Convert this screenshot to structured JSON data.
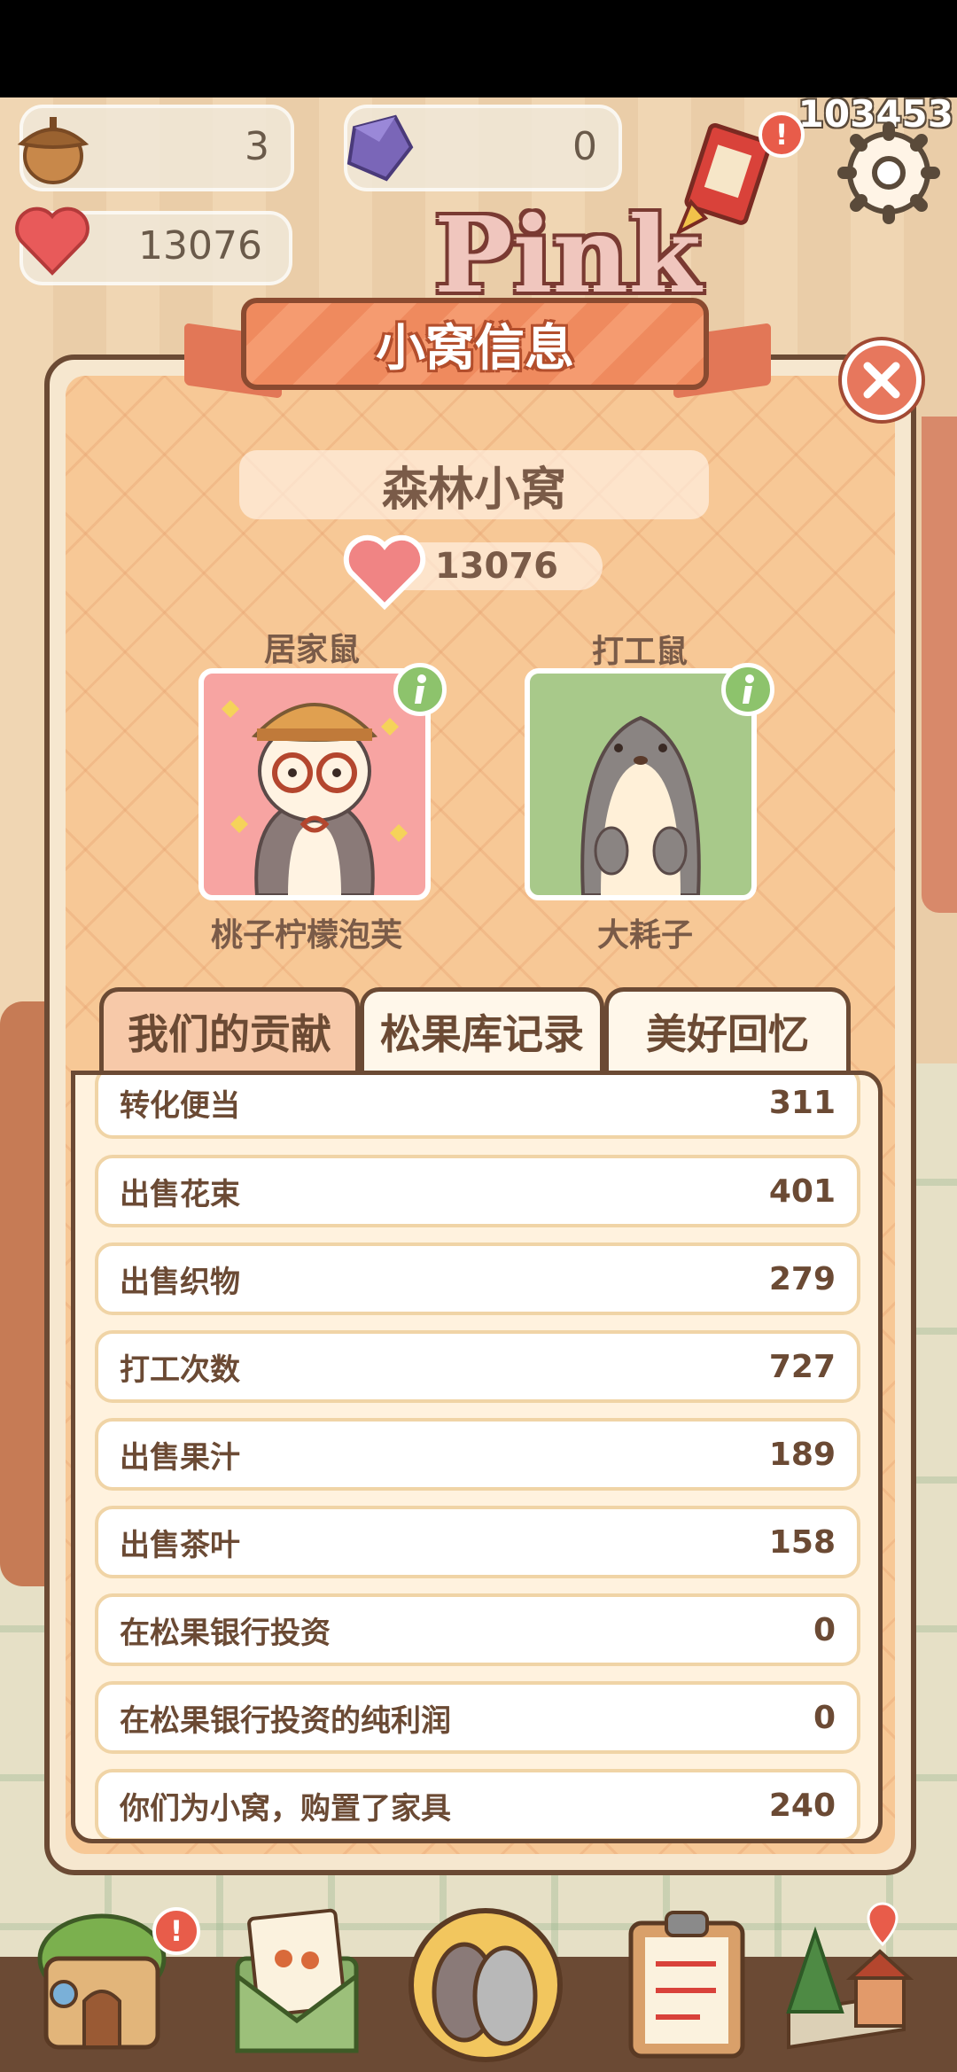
{
  "hud": {
    "acorns": "3",
    "gems": "0",
    "hearts": "13076",
    "score": "103453",
    "sign_text": "Pink"
  },
  "panel": {
    "title": "小窝信息",
    "nest_name": "森林小窝",
    "love_points": "13076",
    "residents": [
      {
        "role": "居家鼠",
        "name": "桃子柠檬泡芙"
      },
      {
        "role": "打工鼠",
        "name": "大耗子"
      }
    ],
    "tabs": [
      {
        "label": "我们的贡献",
        "active": true
      },
      {
        "label": "松果库记录",
        "active": false
      },
      {
        "label": "美好回忆",
        "active": false
      }
    ],
    "stats": [
      {
        "label": "转化便当",
        "value": "311"
      },
      {
        "label": "出售花束",
        "value": "401"
      },
      {
        "label": "出售织物",
        "value": "279"
      },
      {
        "label": "打工次数",
        "value": "727"
      },
      {
        "label": "出售果汁",
        "value": "189"
      },
      {
        "label": "出售茶叶",
        "value": "158"
      },
      {
        "label": "在松果银行投资",
        "value": "0"
      },
      {
        "label": "在松果银行投资的纯利润",
        "value": "0"
      },
      {
        "label": "你们为小窝，购置了家具",
        "value": "240"
      }
    ]
  },
  "colors": {
    "panel_bg": "#f7c896",
    "outline": "#6b4a34",
    "title_banner": "#ef8a5e",
    "close_button": "#e7775d",
    "info_badge": "#8dc36c",
    "alert": "#e85c4a"
  },
  "icons": {
    "close": "close-icon",
    "info": "info-icon",
    "heart": "heart-icon",
    "acorn": "acorn-icon",
    "gem": "gem-icon",
    "settings": "gear-icon"
  }
}
